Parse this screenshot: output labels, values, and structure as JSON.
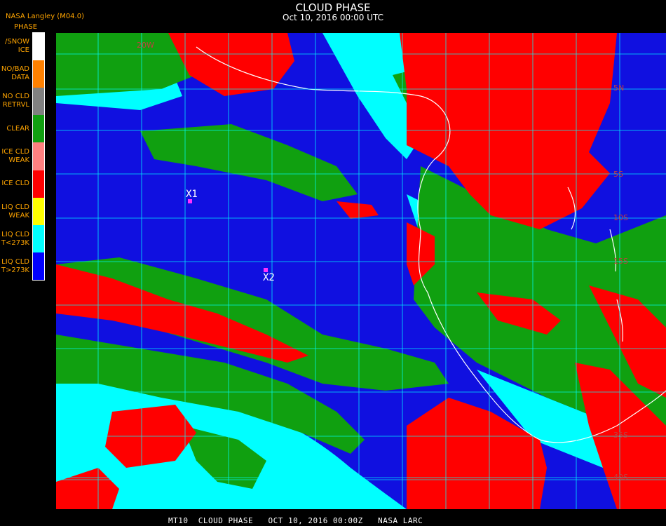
{
  "header": {
    "title": "CLOUD PHASE",
    "subtitle": "Oct 10, 2016 00:00 UTC",
    "producer": "NASA Langley (M04.0)"
  },
  "legend": {
    "heading": "PHASE",
    "entries": [
      {
        "label_lines": [
          "SNOW/",
          "ICE"
        ],
        "color": "#ffffff"
      },
      {
        "label_lines": [
          "NO/BAD",
          "DATA"
        ],
        "color": "#ff8000"
      },
      {
        "label_lines": [
          "NO CLD",
          "RETRVL"
        ],
        "color": "#808080"
      },
      {
        "label_lines": [
          "CLEAR"
        ],
        "color": "#10a010"
      },
      {
        "label_lines": [
          "ICE CLD",
          "WEAK"
        ],
        "color": "#ff8080"
      },
      {
        "label_lines": [
          "ICE CLD"
        ],
        "color": "#ff0000"
      },
      {
        "label_lines": [
          "LIQ CLD",
          "WEAK"
        ],
        "color": "#ffff00"
      },
      {
        "label_lines": [
          "LIQ CLD",
          "T<273K"
        ],
        "color": "#00ffff"
      },
      {
        "label_lines": [
          "LIQ CLD",
          "T>273K"
        ],
        "color": "#0000ff"
      }
    ]
  },
  "map": {
    "markers": [
      {
        "label": "X1"
      },
      {
        "label": "X2"
      }
    ],
    "lat_labels": [
      "20W",
      "5N",
      "5S",
      "10S",
      "15S",
      "35S",
      "40S"
    ],
    "colors": {
      "liquid_warm": "#1010e0",
      "liquid_cold": "#00ffff",
      "ice": "#ff0000",
      "clear": "#10a010",
      "grid": "#00ffff",
      "coast": "#ffffff"
    }
  },
  "footer": {
    "text": "MT10  CLOUD PHASE   OCT 10, 2016 00:00Z   NASA LARC"
  }
}
